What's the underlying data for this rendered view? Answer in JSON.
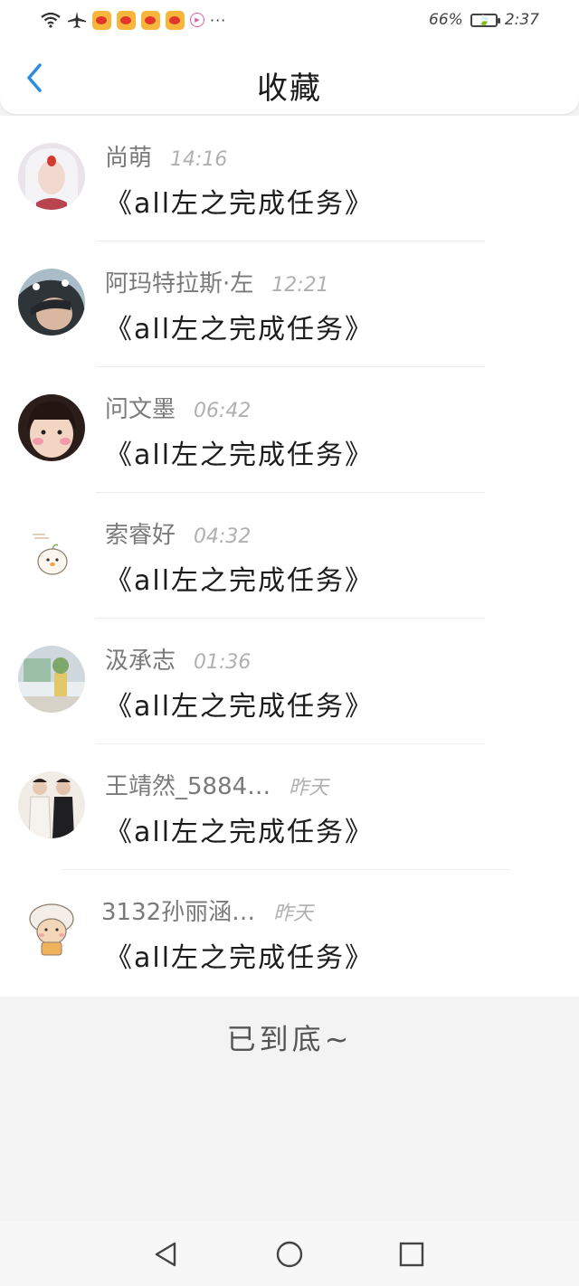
{
  "status_bar": {
    "battery_percent": "66%",
    "time": "2:37",
    "icons": [
      "wifi-icon",
      "airplane-icon",
      "weibo-icon",
      "weibo-icon",
      "weibo-icon",
      "weibo-icon",
      "mini-app-icon",
      "more-dots-icon"
    ],
    "more": "···"
  },
  "header": {
    "title": "收藏"
  },
  "items": [
    {
      "name": "尚萌",
      "time": "14:16",
      "content": "《all左之完成任务》"
    },
    {
      "name": "阿玛特拉斯·左",
      "time": "12:21",
      "content": "《all左之完成任务》"
    },
    {
      "name": "问文墨",
      "time": "06:42",
      "content": "《all左之完成任务》"
    },
    {
      "name": "索睿好",
      "time": "04:32",
      "content": "《all左之完成任务》"
    },
    {
      "name": "汲承志",
      "time": "01:36",
      "content": "《all左之完成任务》"
    },
    {
      "name": "王靖然_5884…",
      "time": "昨天",
      "content": "《all左之完成任务》"
    },
    {
      "name": "3132孙丽涵…",
      "time": "昨天",
      "content": "《all左之完成任务》"
    }
  ],
  "footer": {
    "end_text": "已到底~"
  },
  "colors": {
    "accent": "#2a8de0",
    "page_bg": "#f4f3f4"
  }
}
